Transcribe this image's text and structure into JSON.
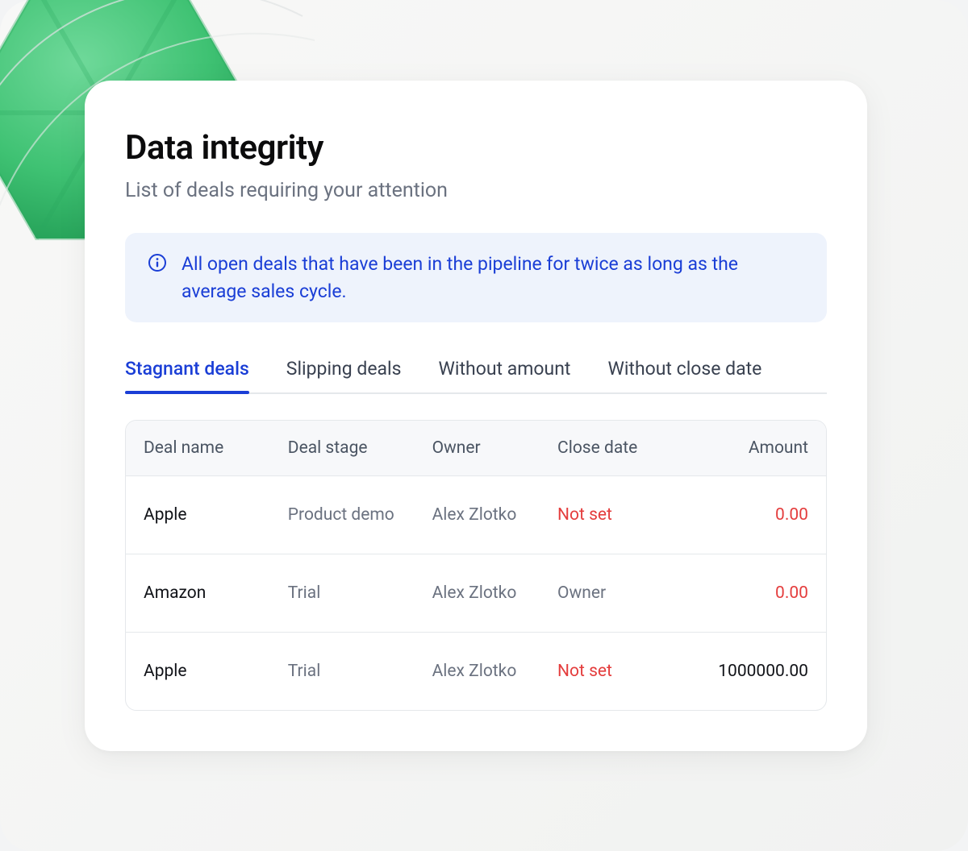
{
  "header": {
    "title": "Data integrity",
    "subtitle": "List of deals requiring your attention"
  },
  "info_banner": {
    "icon": "info-icon",
    "message": "All open deals that have been in the pipeline for twice as long as the average sales cycle."
  },
  "tabs": [
    {
      "id": "stagnant",
      "label": "Stagnant deals",
      "active": true
    },
    {
      "id": "slipping",
      "label": "Slipping deals",
      "active": false
    },
    {
      "id": "no-amount",
      "label": "Without amount",
      "active": false
    },
    {
      "id": "no-close-date",
      "label": "Without close date",
      "active": false
    }
  ],
  "table": {
    "columns": [
      {
        "key": "deal_name",
        "label": "Deal name"
      },
      {
        "key": "deal_stage",
        "label": "Deal stage"
      },
      {
        "key": "owner",
        "label": "Owner"
      },
      {
        "key": "close_date",
        "label": "Close date"
      },
      {
        "key": "amount",
        "label": "Amount"
      }
    ],
    "rows": [
      {
        "deal_name": "Apple",
        "deal_stage": "Product demo",
        "owner": "Alex Zlotko",
        "close_date": "Not set",
        "close_date_warn": true,
        "amount": "0.00",
        "amount_warn": true
      },
      {
        "deal_name": "Amazon",
        "deal_stage": "Trial",
        "owner": "Alex Zlotko",
        "close_date": "Owner",
        "close_date_warn": false,
        "amount": "0.00",
        "amount_warn": true
      },
      {
        "deal_name": "Apple",
        "deal_stage": "Trial",
        "owner": "Alex Zlotko",
        "close_date": "Not set",
        "close_date_warn": true,
        "amount": "1000000.00",
        "amount_warn": false
      }
    ]
  },
  "colors": {
    "accent": "#1a3ed6",
    "warn": "#e43d3d",
    "decor_green": "#3fc273"
  }
}
